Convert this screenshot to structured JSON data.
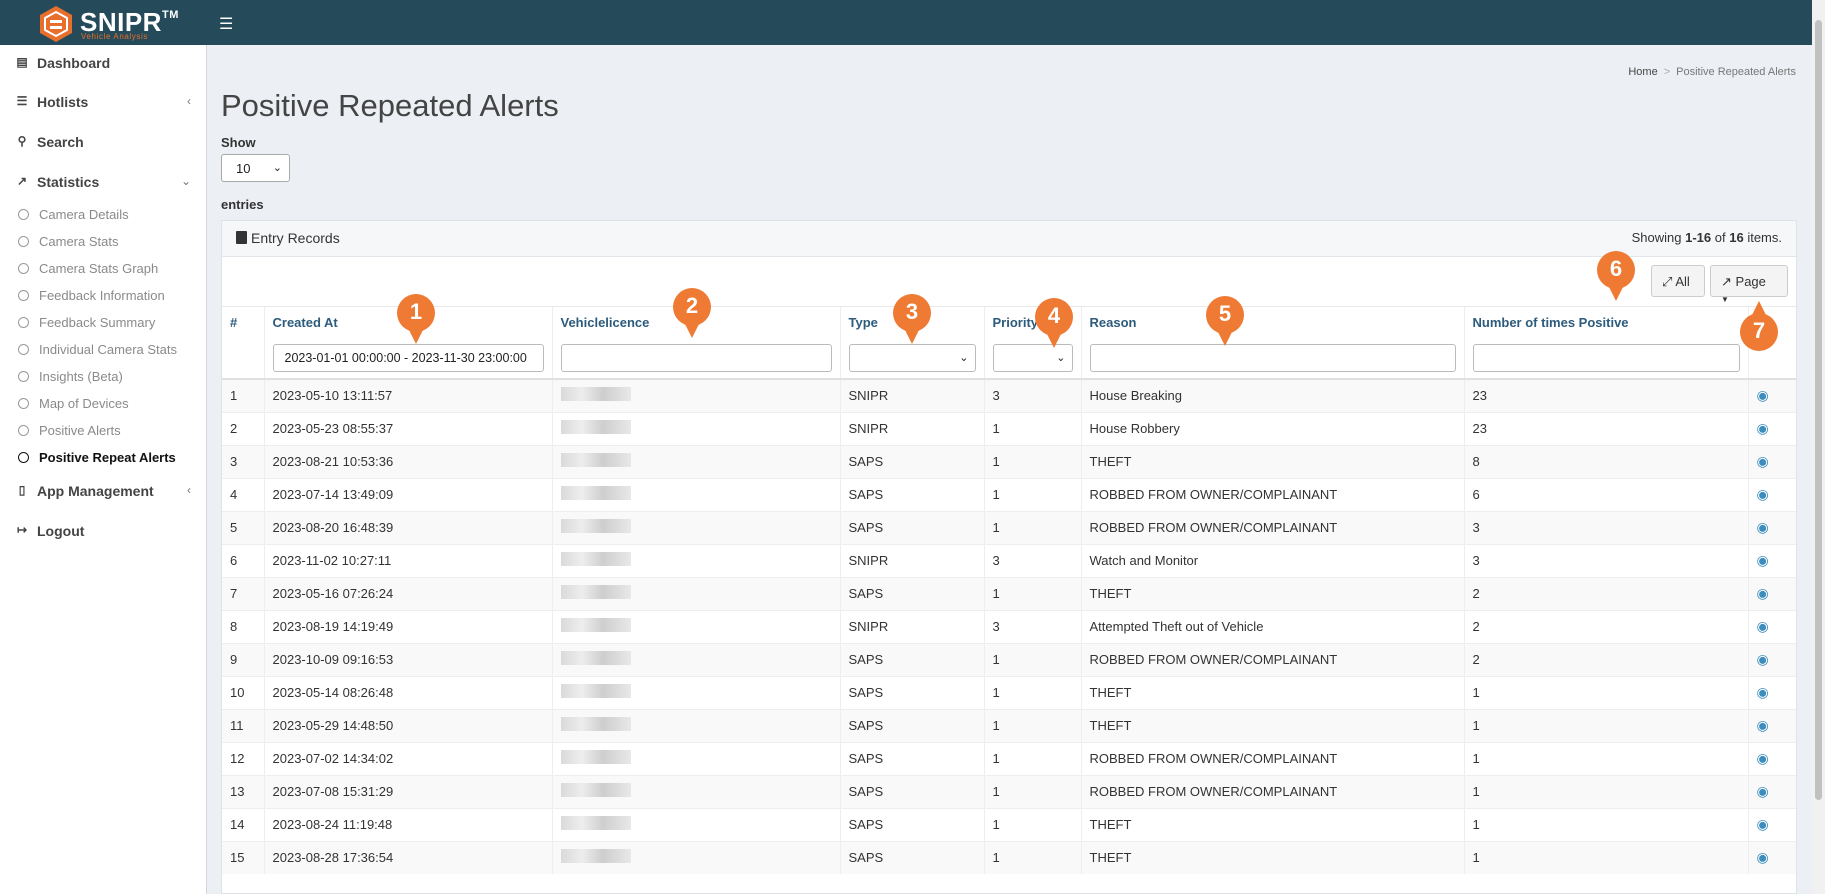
{
  "header": {
    "brand": "SNIPR",
    "trademark": "TM",
    "brand_sub": "Vehicle Analysis",
    "menu_icon": "hamburger-icon"
  },
  "sidebar": {
    "items": [
      {
        "label": "Dashboard",
        "icon": "film-icon"
      },
      {
        "label": "Hotlists",
        "icon": "list-icon"
      },
      {
        "label": "Search",
        "icon": "search-icon"
      },
      {
        "label": "Statistics",
        "icon": "chart-icon"
      },
      {
        "label": "App Management",
        "icon": "mobile-icon"
      },
      {
        "label": "Logout",
        "icon": "logout-icon"
      }
    ],
    "statistics_sub": [
      "Camera Details",
      "Camera Stats",
      "Camera Stats Graph",
      "Feedback Information",
      "Feedback Summary",
      "Individual Camera Stats",
      "Insights (Beta)",
      "Map of Devices",
      "Positive Alerts",
      "Positive Repeat Alerts"
    ]
  },
  "breadcrumb": {
    "home": "Home",
    "current": "Positive Repeated Alerts"
  },
  "page": {
    "title": "Positive Repeated Alerts",
    "show_label": "Show",
    "page_size": "10",
    "entries_label": "entries"
  },
  "box": {
    "title": "Entry Records",
    "summary_prefix": "Showing ",
    "summary_range": "1-16",
    "summary_of": " of ",
    "summary_total": "16",
    "summary_suffix": " items.",
    "btn_all": "All",
    "btn_page": "Page"
  },
  "table": {
    "headers": [
      "#",
      "Created At",
      "Vehiclelicence",
      "Type",
      "Priority",
      "Reason",
      "Number of times Positive"
    ],
    "filter_date": "2023-01-01 00:00:00 - 2023-11-30 23:00:00",
    "rows": [
      [
        "1",
        "2023-05-10 13:11:57",
        "SNIPR",
        "3",
        "House Breaking",
        "23"
      ],
      [
        "2",
        "2023-05-23 08:55:37",
        "SNIPR",
        "1",
        "House Robbery",
        "23"
      ],
      [
        "3",
        "2023-08-21 10:53:36",
        "SAPS",
        "1",
        "THEFT",
        "8"
      ],
      [
        "4",
        "2023-07-14 13:49:09",
        "SAPS",
        "1",
        "ROBBED FROM OWNER/COMPLAINANT",
        "6"
      ],
      [
        "5",
        "2023-08-20 16:48:39",
        "SAPS",
        "1",
        "ROBBED FROM OWNER/COMPLAINANT",
        "3"
      ],
      [
        "6",
        "2023-11-02 10:27:11",
        "SNIPR",
        "3",
        "Watch and Monitor",
        "3"
      ],
      [
        "7",
        "2023-05-16 07:26:24",
        "SAPS",
        "1",
        "THEFT",
        "2"
      ],
      [
        "8",
        "2023-08-19 14:19:49",
        "SNIPR",
        "3",
        "Attempted Theft out of Vehicle",
        "2"
      ],
      [
        "9",
        "2023-10-09 09:16:53",
        "SAPS",
        "1",
        "ROBBED FROM OWNER/COMPLAINANT",
        "2"
      ],
      [
        "10",
        "2023-05-14 08:26:48",
        "SAPS",
        "1",
        "THEFT",
        "1"
      ],
      [
        "11",
        "2023-05-29 14:48:50",
        "SAPS",
        "1",
        "THEFT",
        "1"
      ],
      [
        "12",
        "2023-07-02 14:34:02",
        "SAPS",
        "1",
        "ROBBED FROM OWNER/COMPLAINANT",
        "1"
      ],
      [
        "13",
        "2023-07-08 15:31:29",
        "SAPS",
        "1",
        "ROBBED FROM OWNER/COMPLAINANT",
        "1"
      ],
      [
        "14",
        "2023-08-24 11:19:48",
        "SAPS",
        "1",
        "THEFT",
        "1"
      ],
      [
        "15",
        "2023-08-28 17:36:54",
        "SAPS",
        "1",
        "THEFT",
        "1"
      ]
    ]
  },
  "markers": [
    "1",
    "2",
    "3",
    "4",
    "5",
    "6",
    "7"
  ],
  "colors": {
    "header": "#254b5a",
    "accent": "#ee7a33",
    "link": "#2d5b7c"
  }
}
